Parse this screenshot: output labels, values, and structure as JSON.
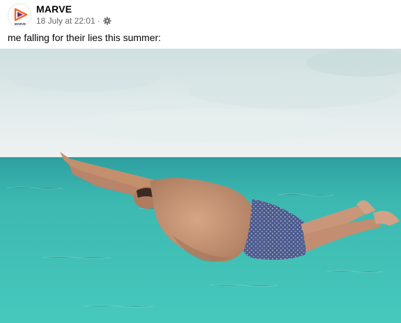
{
  "post": {
    "page_name": "MARVE",
    "timestamp": "18 July at 22:01",
    "separator": "·",
    "privacy_icon": "gear-icon",
    "caption": "me falling for their lies this summer:"
  },
  "avatar": {
    "logo_text": "MARVE",
    "logo_icon": "play-triangle-logo",
    "colors": {
      "orange": "#f26a2e",
      "purple": "#7b2a78",
      "navy": "#1e2a5a"
    }
  },
  "image": {
    "subject": "photo-man-diving-into-sea",
    "colors": {
      "sky": "#dfe9ea",
      "sea": "#3fbfb6",
      "skin": "#c99676",
      "shorts": "#4b5a8c"
    }
  }
}
